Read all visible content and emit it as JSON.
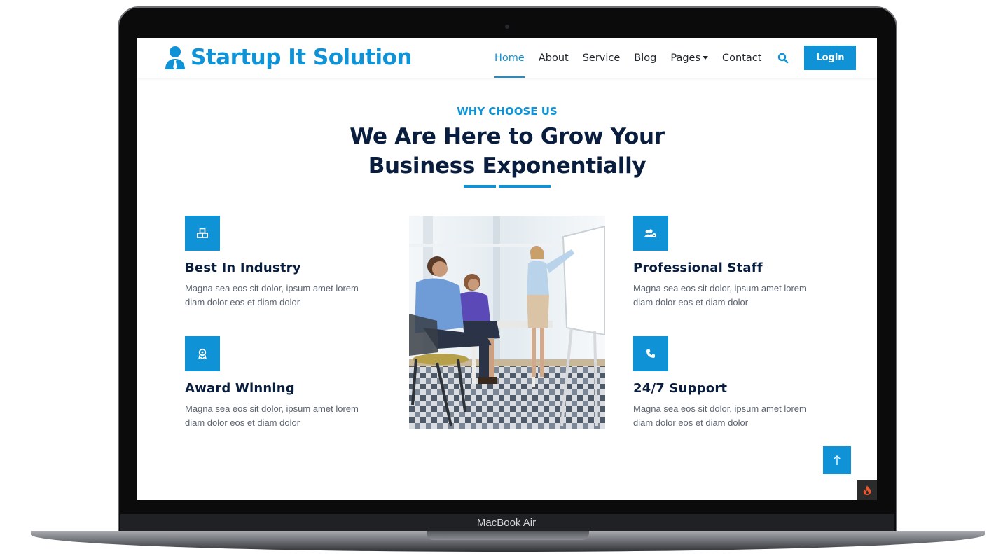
{
  "device": {
    "label": "MacBook Air"
  },
  "navbar": {
    "brand": "Startup It Solution",
    "items": [
      {
        "label": "Home",
        "active": true
      },
      {
        "label": "About"
      },
      {
        "label": "Service"
      },
      {
        "label": "Blog"
      },
      {
        "label": "Pages",
        "dropdown": true
      },
      {
        "label": "Contact"
      }
    ],
    "search_icon": "search-icon",
    "login_label": "Login"
  },
  "section": {
    "subtitle": "WHY CHOOSE US",
    "title": "We Are Here to Grow Your Business Exponentially"
  },
  "features": [
    {
      "icon": "cubes-icon",
      "title": "Best In Industry",
      "text": "Magna sea eos sit dolor, ipsum amet lorem diam dolor eos et diam dolor"
    },
    {
      "icon": "award-icon",
      "title": "Award Winning",
      "text": "Magna sea eos sit dolor, ipsum amet lorem diam dolor eos et diam dolor"
    },
    {
      "icon": "users-gear-icon",
      "title": "Professional Staff",
      "text": "Magna sea eos sit dolor, ipsum amet lorem diam dolor eos et diam dolor"
    },
    {
      "icon": "phone-icon",
      "title": "24/7 Support",
      "text": "Magna sea eos sit dolor, ipsum amet lorem diam dolor eos et diam dolor"
    }
  ],
  "colors": {
    "accent": "#0f93d6",
    "heading": "#091e3e",
    "body_text": "#5c6470"
  }
}
